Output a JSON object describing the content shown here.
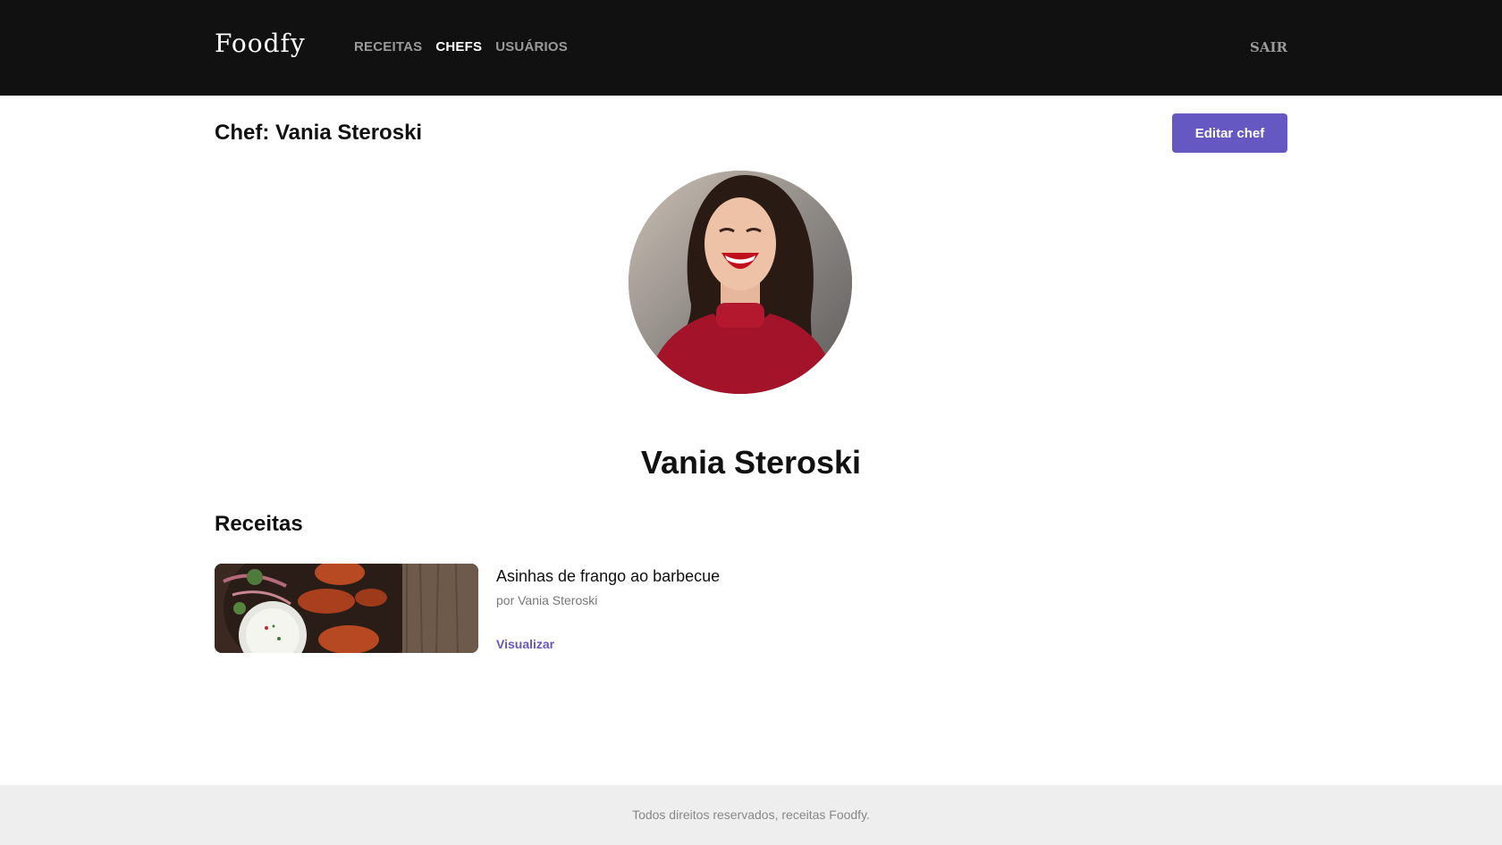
{
  "header": {
    "logo": "Foodfy",
    "nav": [
      {
        "label": "RECEITAS",
        "active": false
      },
      {
        "label": "CHEFS",
        "active": true
      },
      {
        "label": "USUÁRIOS",
        "active": false
      }
    ],
    "logout_label": "SAIR"
  },
  "main": {
    "page_title": "Chef: Vania Steroski",
    "edit_button_label": "Editar chef",
    "chef_name": "Vania Steroski",
    "recipes_title": "Receitas",
    "recipes": [
      {
        "title": "Asinhas de frango ao barbecue",
        "author": "por Vania Steroski",
        "link_label": "Visualizar"
      }
    ]
  },
  "footer": {
    "text": "Todos direitos reservados, receitas Foodfy."
  },
  "colors": {
    "header_bg": "#111111",
    "accent": "#6558c3",
    "footer_bg": "#eeeeee"
  }
}
